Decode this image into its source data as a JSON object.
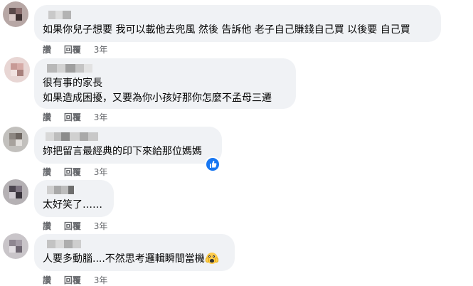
{
  "actions": {
    "like": "讚",
    "reply": "回覆",
    "time": "3年"
  },
  "comments": [
    {
      "lines": [
        "如果你兒子想要 我可以載他去兜風 然後 告訴他 老子自己賺錢自己買 以後要 自己買"
      ]
    },
    {
      "lines": [
        "很有事的家長",
        "如果造成困擾，又要為你小孩好那你怎麼不孟母三遷"
      ]
    },
    {
      "lines": [
        "妳把留言最經典的印下來給那位媽媽"
      ]
    },
    {
      "lines": [
        "太好笑了……"
      ]
    },
    {
      "lines": [
        "人要多動腦....不然思考邏輯瞬間當機"
      ]
    }
  ],
  "reaction_icons": {
    "comment_3": "like-thumb-icon",
    "comment_5_emoji": "screaming-face-emoji"
  },
  "colors": {
    "bubble": "#f0f2f5",
    "text": "#050505",
    "meta": "#65676b",
    "like_blue": "#1877f2"
  }
}
